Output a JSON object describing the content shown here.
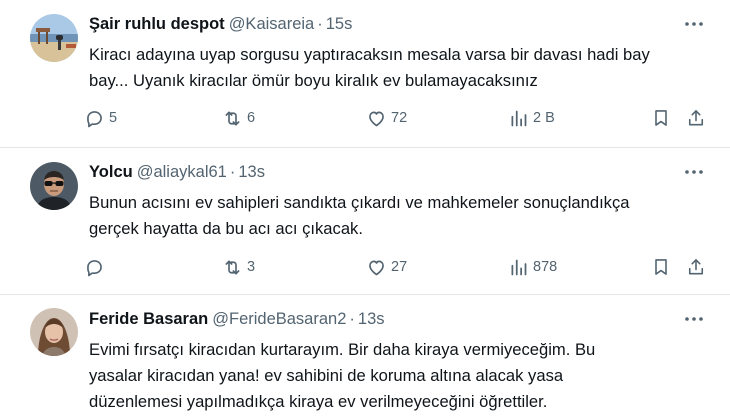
{
  "tweets": [
    {
      "display_name": "Şair ruhlu despot",
      "handle": "@Kaisareia",
      "separator": "·",
      "time": "15s",
      "text": "Kiracı adayına uyap sorgusu yaptıracaksın mesala varsa bir davası hadi bay\nbay...  Uyanık kiracılar ömür boyu kiralık ev bulamayacaksınız",
      "replies": "5",
      "retweets": "6",
      "likes": "72",
      "views": "2 B",
      "avatar": "beach-photo-avatar"
    },
    {
      "display_name": "Yolcu",
      "handle": "@aliaykal61",
      "separator": "·",
      "time": "13s",
      "text": "Bunun acısını ev sahipleri sandıkta çıkardı ve mahkemeler sonuçlandıkça\ngerçek hayatta da bu acı acı çıkacak.",
      "replies": "",
      "retweets": "3",
      "likes": "27",
      "views": "878",
      "avatar": "man-sunglasses-avatar"
    },
    {
      "display_name": "Feride Basaran",
      "handle": "@FerideBasaran2",
      "separator": "·",
      "time": "13s",
      "text": "Evimi fırsatçı kiracıdan kurtarayım. Bir daha kiraya vermiyeceğim. Bu\nyasalar kiracıdan yana!  ev sahibini de koruma altına alacak yasa\ndüzenlemesi yapılmadıkça kiraya ev verilmeyeceğini öğrettiler.",
      "avatar": "woman-portrait-avatar"
    }
  ],
  "colors": {
    "text": "#0f1419",
    "muted": "#536471",
    "divider": "#e3e7ea"
  },
  "icons": [
    "reply-icon",
    "retweet-icon",
    "like-icon",
    "views-icon",
    "bookmark-icon",
    "share-icon",
    "more-icon"
  ]
}
